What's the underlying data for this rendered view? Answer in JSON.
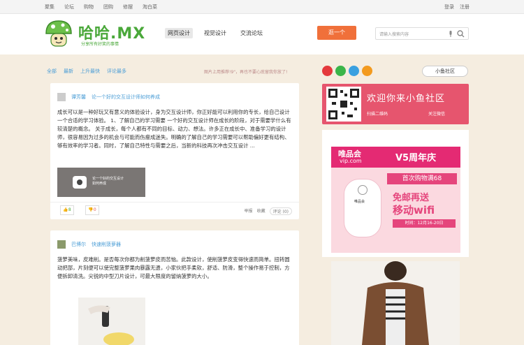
{
  "topbar": {
    "links": [
      "聚集",
      "论坛",
      "购物",
      "团购",
      "修摆",
      "淘白菜"
    ],
    "login": "登录",
    "register": "注册"
  },
  "header": {
    "logo": "哈哈.MX",
    "slogan": "分享所有好笑的事情",
    "nav": [
      "网页设计",
      "视觉设计",
      "交流论坛"
    ],
    "cta": "逛一个",
    "search_placeholder": "请输入搜索内容"
  },
  "filters": [
    "全部",
    "最新",
    "上升最快",
    "评论最多"
  ],
  "notice": "图片上用推荐!9\"，再也不要心底留我你放了!",
  "community_tab": "小鱼社区",
  "post1": {
    "author": "谭芳馨",
    "title": "论一个好的交互设计师如何养成",
    "body": "成长可以是一种好玩又有意义的体验设计，身为交互设计师，你正好能可以利用你的专长，给自己设计一个合适的学习体验。     1、了解自己的学习需要  一个好的交互设计师在成长的阶段，对于需要学什么有较清楚的概念。  关于成长，每个人都有不同的目标、动力、想法。许多正在成长中、准备学习的设计师，很容易因为过多的机会与可能而伤瘦成迷失。明确的了解自己的学习需要可以帮助偏好更有结构、够有效率的学习者。同时，了解自己特性与需要之后，当新的科技再次冲击交互设计  ...",
    "thumb_caption": "论一个好的交互设计\n如何养成",
    "up": "8",
    "down": "0",
    "action_share": "举报",
    "action_fav": "收藏",
    "comments": "评论 (0)"
  },
  "post2": {
    "author": "巴博尔",
    "title": "快速削菠萝器",
    "body": "菠萝美味，皮难削。是否每次你都为削菠萝皮而苦恼。此款设计，使削菠萝皮变得快速而简单。扭转圆动把部，片刻便可以使完整菠萝果肉暴露无遗，小家伙把手柔软，舒适、防滑，整个操作易于控制，方便拆卸清洗。尖锐的中型刀片设计，可最大限度的留纳菠萝的大小。"
  },
  "qr_banner": {
    "title": "欢迎你来小鱼社区",
    "sub1": "扫描二维码",
    "sub2": "关注微信"
  },
  "ad": {
    "logo": "唯品会",
    "url": "vip.com",
    "anniversary": "V5周年庆",
    "line1": "首次购物满68",
    "line2": "免邮再送",
    "line3": "移动wifi",
    "line4": "时间：12月16-20日",
    "device_label": "唯品会"
  }
}
